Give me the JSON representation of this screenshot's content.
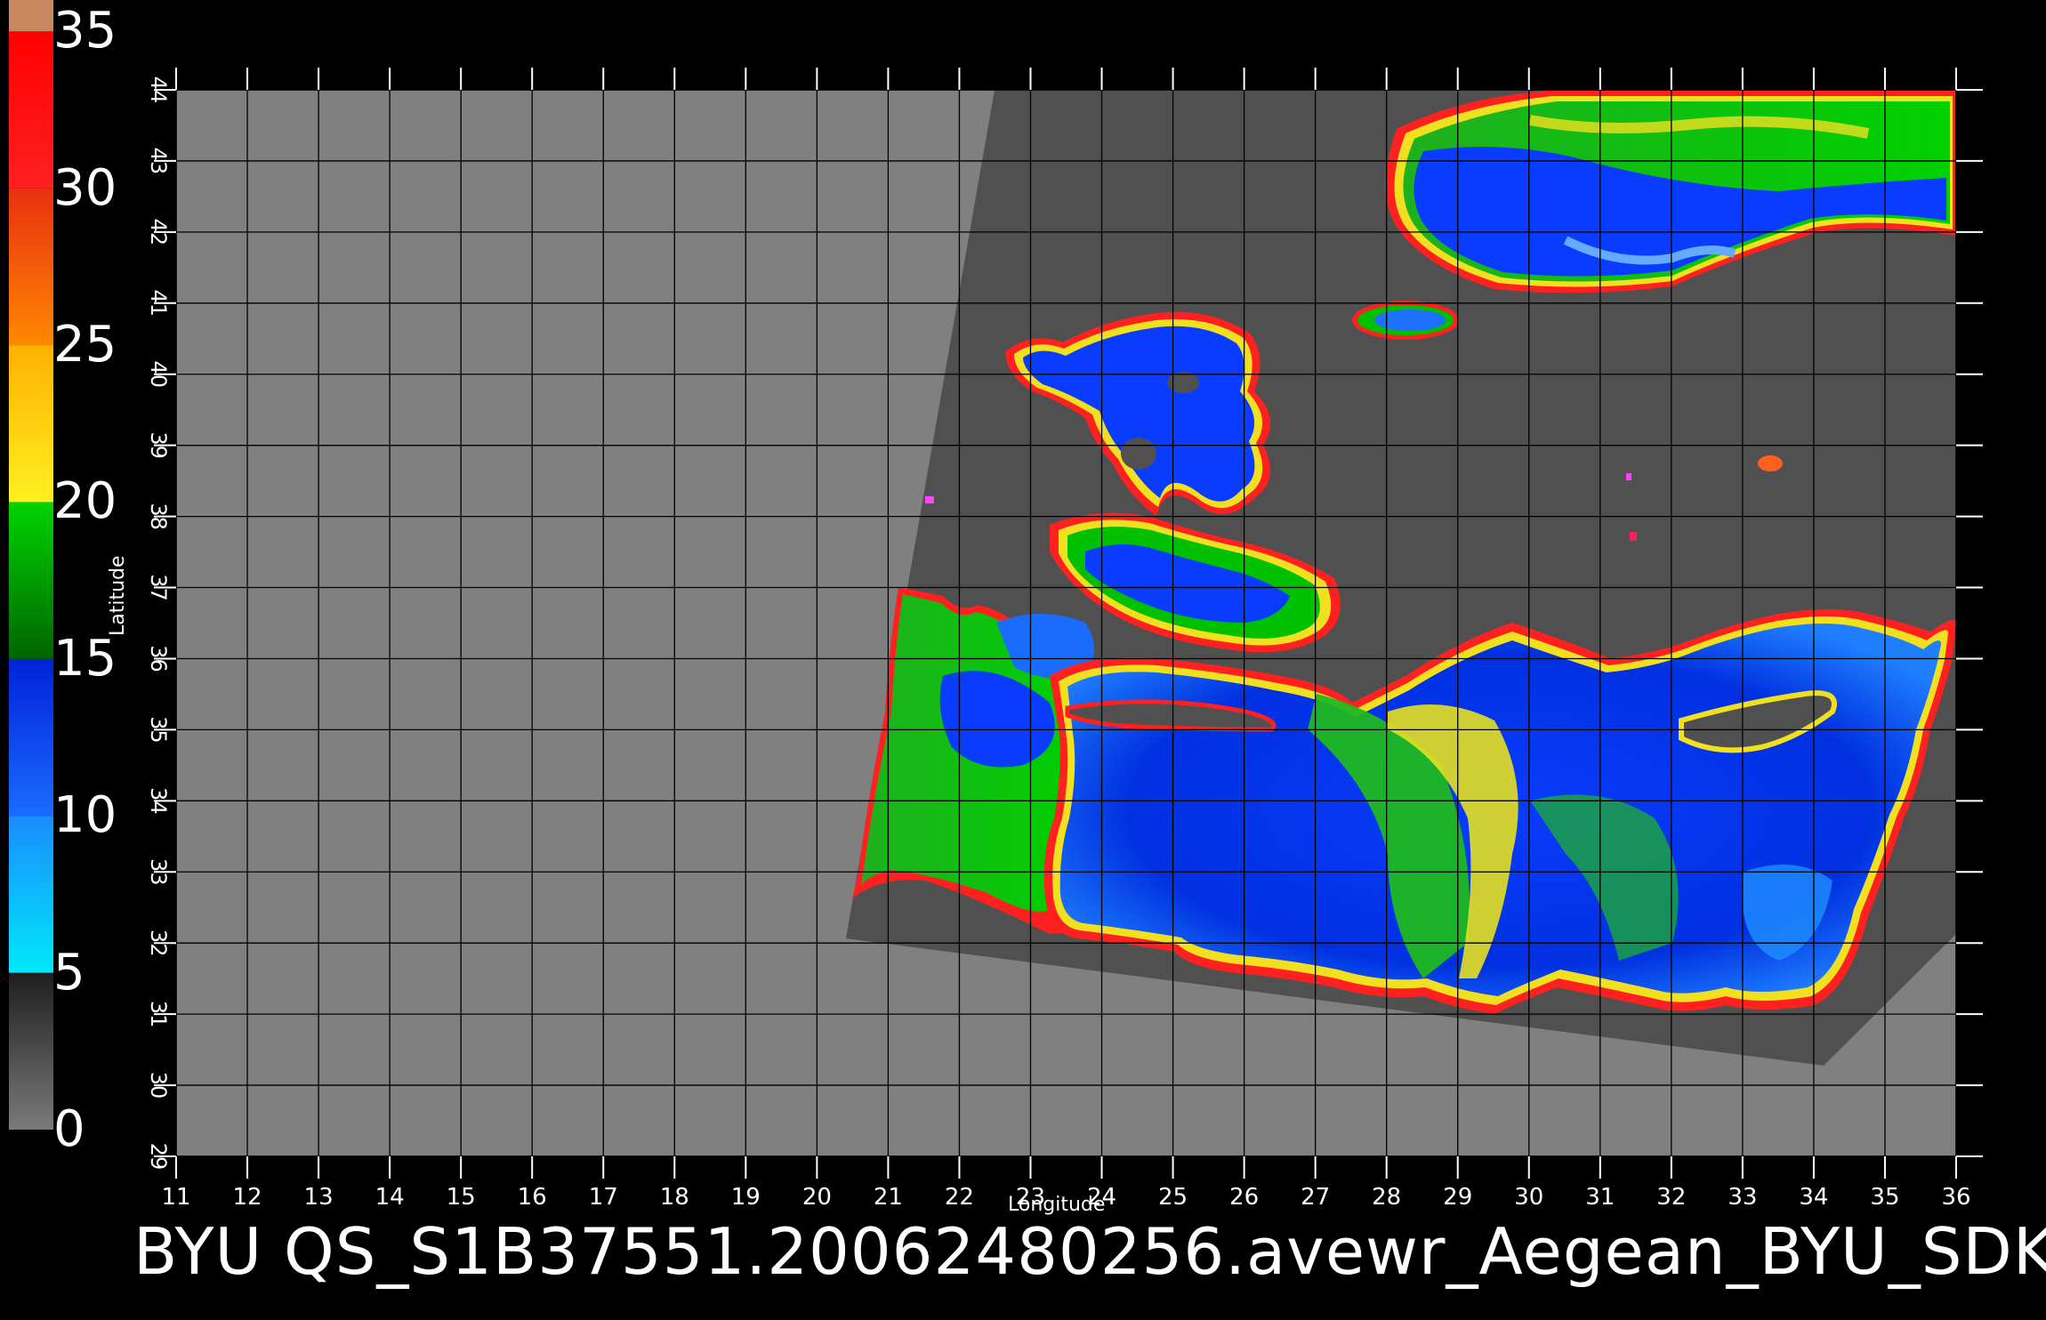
{
  "footer": {
    "title": "BYU  QS_S1B37551.20062480256.avewr_Aegean_BYU_SDK"
  },
  "axes": {
    "xlabel": "Longitude",
    "ylabel": "Latitude",
    "x_ticks": [
      "11",
      "12",
      "13",
      "14",
      "15",
      "16",
      "17",
      "18",
      "19",
      "20",
      "21",
      "22",
      "23",
      "24",
      "25",
      "26",
      "27",
      "28",
      "29",
      "30",
      "31",
      "32",
      "33",
      "34",
      "35",
      "36"
    ],
    "y_ticks": [
      "29",
      "30",
      "31",
      "32",
      "33",
      "34",
      "35",
      "36",
      "37",
      "38",
      "39",
      "40",
      "41",
      "42",
      "43",
      "44"
    ],
    "xlim": [
      11,
      36
    ],
    "ylim": [
      29,
      44
    ],
    "grid": true
  },
  "colorbar": {
    "labels": [
      "35",
      "30",
      "25",
      "20",
      "15",
      "10",
      "5",
      "0"
    ],
    "segments": [
      {
        "from": 0,
        "to": 5,
        "colors": [
          "#7a7a7a",
          "#1e1e1e"
        ]
      },
      {
        "from": 5,
        "to": 10,
        "colors": [
          "#00e8f8",
          "#1a8cff"
        ]
      },
      {
        "from": 10,
        "to": 15,
        "colors": [
          "#1a6cff",
          "#0022d8"
        ]
      },
      {
        "from": 15,
        "to": 20,
        "colors": [
          "#006400",
          "#00d400"
        ]
      },
      {
        "from": 20,
        "to": 25,
        "colors": [
          "#fff020",
          "#ffb000"
        ]
      },
      {
        "from": 25,
        "to": 30,
        "colors": [
          "#ff8800",
          "#e83010"
        ]
      },
      {
        "from": 30,
        "to": 35,
        "colors": [
          "#ff2020",
          "#ff0000"
        ]
      },
      {
        "from": 35,
        "to": 36,
        "colors": [
          "#c88860",
          "#c88860"
        ]
      }
    ]
  },
  "colors": {
    "background": "#000000",
    "no_data": "#808080",
    "land": "#505050",
    "grid": "#000000"
  }
}
